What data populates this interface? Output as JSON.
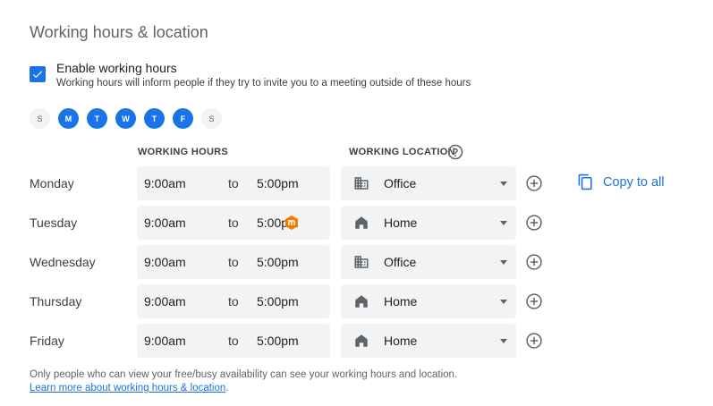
{
  "title": "Working hours & location",
  "enable": {
    "checked": true,
    "label": "Enable working hours",
    "description": "Working hours will inform people if they try to invite you to a meeting outside of these hours"
  },
  "days": [
    {
      "letter": "S",
      "active": false
    },
    {
      "letter": "M",
      "active": true
    },
    {
      "letter": "T",
      "active": true
    },
    {
      "letter": "W",
      "active": true
    },
    {
      "letter": "T",
      "active": true
    },
    {
      "letter": "F",
      "active": true
    },
    {
      "letter": "S",
      "active": false
    }
  ],
  "columns": {
    "hours": "WORKING HOURS",
    "location": "WORKING LOCATION"
  },
  "schedule": [
    {
      "day": "Monday",
      "from": "9:00am",
      "to_label": "to",
      "until": "5:00pm",
      "location": "Office",
      "location_icon": "office-building-icon"
    },
    {
      "day": "Tuesday",
      "from": "9:00am",
      "to_label": "to",
      "until": "5:00pm",
      "location": "Home",
      "location_icon": "home-icon"
    },
    {
      "day": "Wednesday",
      "from": "9:00am",
      "to_label": "to",
      "until": "5:00pm",
      "location": "Office",
      "location_icon": "office-building-icon"
    },
    {
      "day": "Thursday",
      "from": "9:00am",
      "to_label": "to",
      "until": "5:00pm",
      "location": "Home",
      "location_icon": "home-icon"
    },
    {
      "day": "Friday",
      "from": "9:00am",
      "to_label": "to",
      "until": "5:00pm",
      "location": "Home",
      "location_icon": "home-icon"
    }
  ],
  "copy_all": "Copy to all",
  "footer": {
    "note": "Only people who can view your free/busy availability can see your working hours and location.",
    "link": "Learn more about working hours & location",
    "link_suffix": "."
  },
  "colors": {
    "accent": "#1a73e8",
    "field_bg": "#f1f3f4",
    "cursor": "#f57c00"
  }
}
